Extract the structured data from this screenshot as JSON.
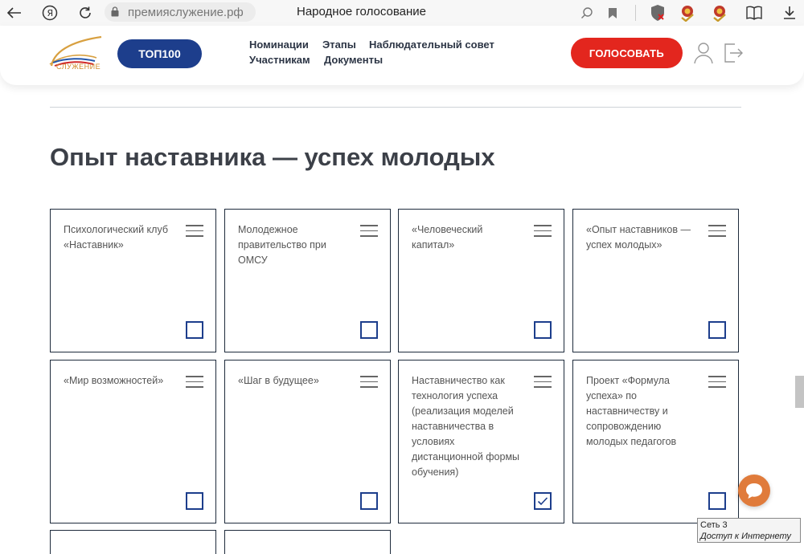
{
  "browser": {
    "address": "премияслужение.рф",
    "tab_title": "Народное голосование",
    "icons": [
      "back-arrow-icon",
      "yandex-icon",
      "reload-icon",
      "lock-icon",
      "search-icon",
      "bookmark-icon",
      "shield-icon",
      "extension-icon",
      "extension-icon",
      "reader-icon",
      "download-icon"
    ]
  },
  "header": {
    "logo_text": "СЛУЖЕНИЕ",
    "top_button": "ТОП100",
    "nav": [
      "Номинации",
      "Этапы",
      "Наблюдательный совет",
      "Участникам",
      "Документы"
    ],
    "vote_button": "ГОЛОСОВАТЬ"
  },
  "section": {
    "title": "Опыт наставника — успех молодых"
  },
  "cards": [
    {
      "text": "Психологический клуб «Наставник»",
      "checked": false
    },
    {
      "text": "Молодежное правительство при ОМСУ",
      "checked": false
    },
    {
      "text": "«Человеческий капитал»",
      "checked": false
    },
    {
      "text": "«Опыт наставников — успех молодых»",
      "checked": false
    },
    {
      "text": "«Мир возможностей»",
      "checked": false
    },
    {
      "text": "«Шаг в будущее»",
      "checked": false
    },
    {
      "text": "Наставничество как технология успеха (реализация моделей наставничества в условиях дистанционной формы обучения)",
      "checked": true
    },
    {
      "text": "Проект «Формула успеха» по наставничеству и сопровождению молодых педагогов",
      "checked": false
    }
  ],
  "tooltip": {
    "line1": "Сеть 3",
    "line2": "Доступ к Интернету"
  },
  "colors": {
    "brand_blue": "#1d3e8c",
    "vote_red": "#e3261e",
    "chat_orange": "#e07b3b"
  }
}
